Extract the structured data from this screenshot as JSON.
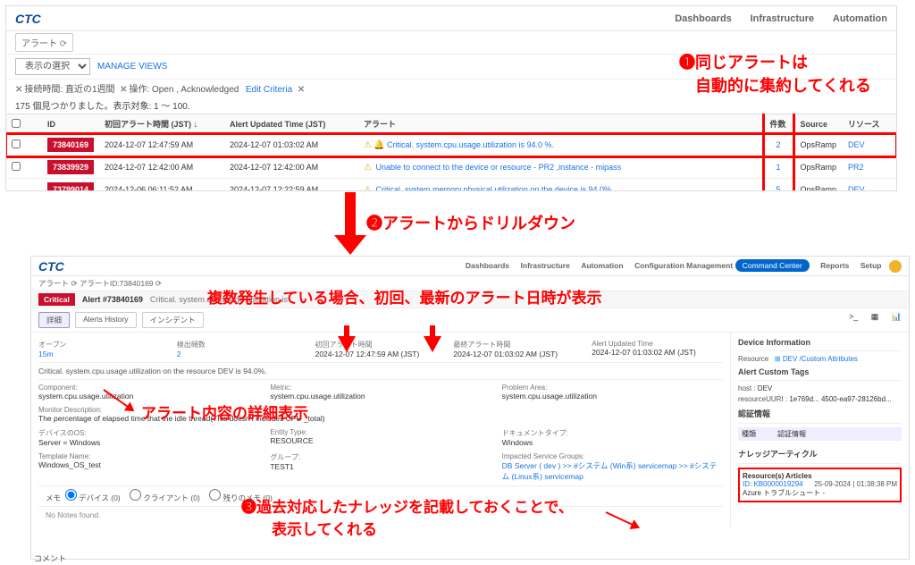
{
  "top": {
    "logo": "CTC",
    "nav": [
      "Dashboards",
      "Infrastructure",
      "Automation"
    ],
    "breadcrumb": "アラート",
    "view_select": "表示の選択",
    "manage_views": "MANAGE VIEWS",
    "filter1_label": "接続時間: 直近の1週間",
    "filter2_label": "操作: Open , Acknowledged",
    "edit_criteria": "Edit Criteria",
    "summary": "175 個見つかりました。表示対象: 1 ～ 100.",
    "cols": {
      "id": "ID",
      "first": "初回アラート時間 (JST)",
      "updated": "Alert Updated Time (JST)",
      "alert": "アラート",
      "count": "件数",
      "source": "Source",
      "resource": "リソース"
    },
    "rows": [
      {
        "id": "73840169",
        "first": "2024-12-07 12:47:59 AM",
        "updated": "2024-12-07 01:03:02 AM",
        "msg": "Critical. system.cpu.usage.utilization is 94.0 %.",
        "count": "2",
        "source": "OpsRamp",
        "resource": "DEV",
        "hl": true,
        "icons": true
      },
      {
        "id": "73839929",
        "first": "2024-12-07 12:42:00 AM",
        "updated": "2024-12-07 12:42:00 AM",
        "msg": "Unable to connect to the device or resource - PR2 ,instance - mipass",
        "count": "1",
        "source": "OpsRamp",
        "resource": "PR2"
      },
      {
        "id": "73799014",
        "first": "2024-12-06 06:11:52 AM",
        "updated": "2024-12-07 12:22:59 AM",
        "msg": "Critical. system.memory.physical.utilization on the device is 94.0%.",
        "count": "5",
        "source": "OpsRamp",
        "resource": "DEV"
      }
    ]
  },
  "bot": {
    "nav": [
      "Dashboards",
      "Infrastructure",
      "Automation",
      "Configuration Management"
    ],
    "cc": "Command Center",
    "nav2": [
      "Reports",
      "Setup"
    ],
    "crumb": "アラート  ⟳   アラートID:73840169  ⟳",
    "crit": "Critical",
    "alert_title": "Alert #73840169",
    "alert_sub": "Critical. system.cpu.usage.utilization is",
    "tabs": [
      "詳細",
      "Alerts History",
      "インシデント"
    ],
    "kv": {
      "open_k": "オープン",
      "open_v": "15m",
      "occ_k": "検出頻数",
      "occ_v": "2",
      "first_k": "初回アラート時間",
      "first_v": "2024-12-07 12:47:59 AM (JST)",
      "last_k": "最終アラート時間",
      "last_v": "2024-12-07 01:03:02 AM (JST)",
      "upd_k": "Alert Updated Time",
      "upd_v": "2024-12-07 01:03:02 AM (JST)"
    },
    "subline": "Critical. system.cpu.usage.utilization on the resource DEV is 94.0%.",
    "g": {
      "comp_k": "Component:",
      "comp_v": "system.cpu.usage.utilization",
      "metric_k": "Metric:",
      "metric_v": "system.cpu.usage.utilization",
      "pa_k": "Problem Area:",
      "pa_v": "system.cpu.usage.utilization",
      "md_k": "Monitor Description:",
      "md_v": "The percentage of elapsed time that the idle thread(This doesn't includes CPU _total)",
      "dev_k": "デバイスのOS:",
      "dev_v": "Server = Windows",
      "ent_k": "Entity Type:",
      "ent_v": "RESOURCE",
      "doc_k": "ドキュメントタイプ:",
      "doc_v": "Windows",
      "tmpl_k": "Template Name:",
      "tmpl_v": "Windows_OS_test",
      "grp_k": "グループ:",
      "grp_v": "TEST1",
      "isg_k": "Impacted Service Groups:",
      "isg_v": "DB Server ( dev ) >> #システム (Win系) servicemap >> #システム (Linux系) servicemap"
    },
    "memo_label": "メモ",
    "memo_opts": [
      "デバイス (0)",
      "クライアント (0)",
      "残りのメモ (0)"
    ],
    "notes": "No Notes found.",
    "side": {
      "dev_info": "Device Information",
      "resource_k": "Resource",
      "resource_v": "DEV  /Custom Attributes",
      "tags": "Alert Custom Tags",
      "host_k": "host",
      "host_v": "DEV",
      "ruri_k": "resourceUURI :",
      "ruri_v": "1e769d... 4500-ea97-28126bd...",
      "auth": "認証情報",
      "auth_th1": "種類",
      "auth_th2": "認証情報",
      "kb": "ナレッジアーティクル",
      "kb_h": "Resource(s) Articles",
      "kb_id": "ID: KB0000019294",
      "kb_date": "25-09-2024 | 01:38:38 PM",
      "kb_t": "Azure トラブルシュート -"
    }
  },
  "annot": {
    "a1": "❶同じアラートは\n　自動的に集約してくれる",
    "a2": "❷アラートからドリルダウン",
    "a3": "複数発生している場合、初回、最新のアラート日時が表示",
    "a4": "アラート内容の詳細表示",
    "a5": "❸過去対応したナレッジを記載しておくことで、\n　　表示してくれる",
    "comment": "コメント"
  }
}
